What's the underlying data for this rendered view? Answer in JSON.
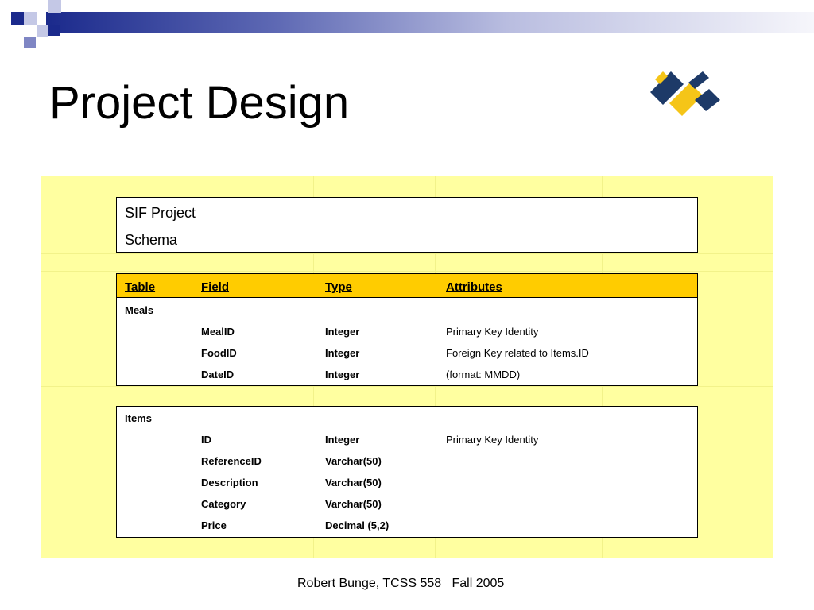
{
  "slide": {
    "title": "Project Design",
    "footer": "Robert Bunge, TCSS 558   Fall 2005",
    "accent_colors": {
      "band_dark": "#1b2a8c",
      "logo_navy": "#1d3a68",
      "logo_yellow": "#f5c518",
      "panel_bg": "#ffffa0",
      "header_bg": "#ffcc00"
    }
  },
  "schema": {
    "project_label": "SIF Project",
    "schema_label": "Schema"
  },
  "columns": {
    "table": "Table",
    "field": "Field",
    "type": "Type",
    "attributes": "Attributes"
  },
  "meals": {
    "name": "Meals",
    "rows": [
      {
        "field": "MealID",
        "type": "Integer",
        "attr": "Primary Key Identity"
      },
      {
        "field": "FoodID",
        "type": "Integer",
        "attr": "Foreign Key related to Items.ID"
      },
      {
        "field": "DateID",
        "type": "Integer",
        "attr": "(format: MMDD)"
      }
    ]
  },
  "items": {
    "name": "Items",
    "rows": [
      {
        "field": "ID",
        "type": "Integer",
        "attr": "Primary Key Identity"
      },
      {
        "field": "ReferenceID",
        "type": "Varchar(50)",
        "attr": ""
      },
      {
        "field": "Description",
        "type": "Varchar(50)",
        "attr": ""
      },
      {
        "field": "Category",
        "type": "Varchar(50)",
        "attr": ""
      },
      {
        "field": "Price",
        "type": "Decimal (5,2)",
        "attr": ""
      }
    ]
  }
}
